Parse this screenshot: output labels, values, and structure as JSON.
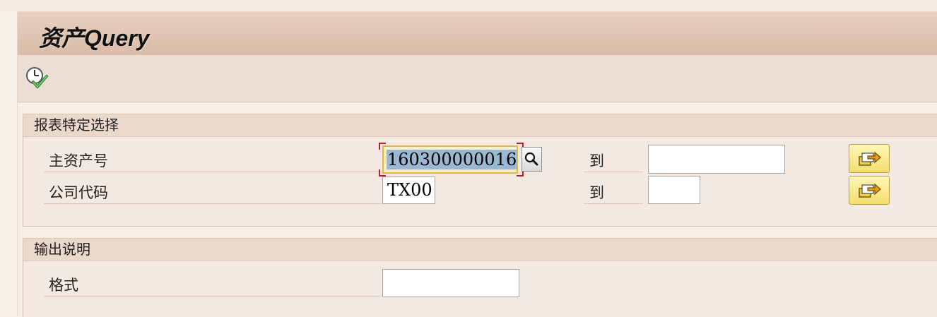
{
  "header": {
    "title": "资产Query"
  },
  "toolbar": {
    "execute_icon": "clock-check-icon"
  },
  "selection_group": {
    "title": "报表特定选择",
    "rows": [
      {
        "label": "主资产号",
        "from_value": "160300000016",
        "to_label": "到",
        "to_value": ""
      },
      {
        "label": "公司代码",
        "from_value": "TX00",
        "to_label": "到",
        "to_value": ""
      }
    ]
  },
  "output_group": {
    "title": "输出说明",
    "rows": [
      {
        "label": "格式",
        "value": ""
      }
    ]
  },
  "colors": {
    "title_bar": "#d9bca8",
    "group_header": "#ecd8ca",
    "background": "#f4e9e1",
    "active_field": "#f5f0c5",
    "selection": "#9bb7d4"
  }
}
